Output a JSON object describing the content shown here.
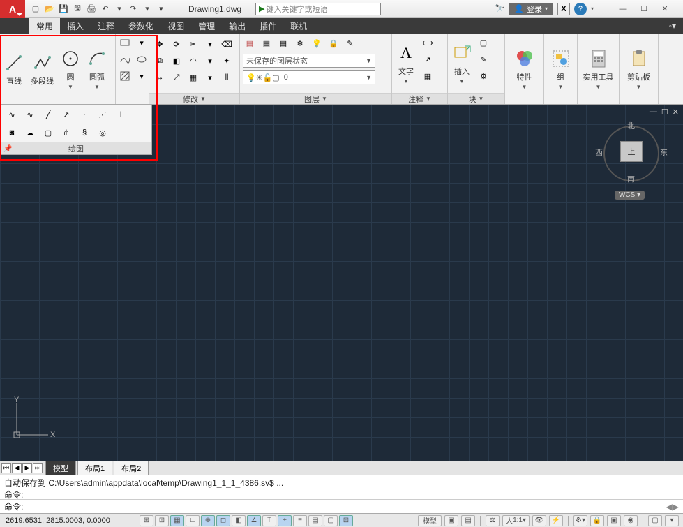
{
  "title": "Drawing1.dwg",
  "search_placeholder": "键入关键字或短语",
  "login_label": "登录",
  "menu": {
    "items": [
      "常用",
      "插入",
      "注释",
      "参数化",
      "视图",
      "管理",
      "输出",
      "插件",
      "联机"
    ],
    "active": 0
  },
  "ribbon": {
    "draw": {
      "line": "直线",
      "polyline": "多段线",
      "circle": "圆",
      "arc": "圆弧",
      "title": "绘图"
    },
    "modify_title": "修改",
    "layers": {
      "title": "图层",
      "state": "未保存的图层状态",
      "current": "0"
    },
    "anno": {
      "title": "注释",
      "text": "文字"
    },
    "block": {
      "title": "块",
      "insert": "插入"
    },
    "props": "特性",
    "group": "组",
    "utils": "实用工具",
    "clip": "剪贴板"
  },
  "viewcube": {
    "n": "北",
    "s": "南",
    "e": "东",
    "w": "西",
    "top": "上",
    "wcs": "WCS"
  },
  "tabs": {
    "model": "模型",
    "layout1": "布局1",
    "layout2": "布局2"
  },
  "cmd": {
    "hist1": "自动保存到 C:\\Users\\admin\\appdata\\local\\temp\\Drawing1_1_1_4386.sv$ ...",
    "hist2": "命令:",
    "prompt": "命令:"
  },
  "status": {
    "coords": "2619.6531, 2815.0003, 0.0000",
    "model": "模型",
    "scale": "1:1"
  }
}
